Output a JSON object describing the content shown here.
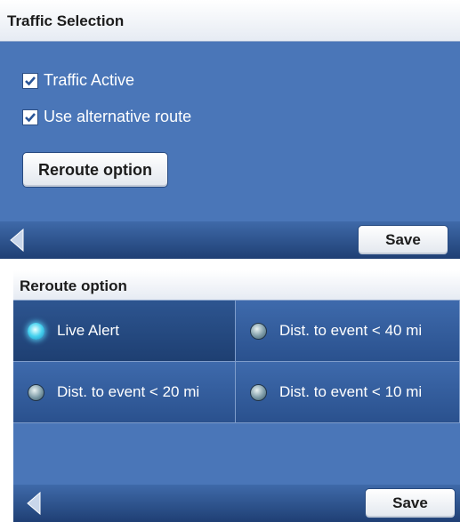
{
  "traffic_selection": {
    "title": "Traffic Selection",
    "checkboxes": [
      {
        "label": "Traffic Active",
        "checked": true
      },
      {
        "label": "Use alternative route",
        "checked": true
      }
    ],
    "reroute_button": "Reroute option",
    "save_label": "Save"
  },
  "reroute_option": {
    "title": "Reroute option",
    "options": [
      {
        "label": "Live Alert",
        "selected": true
      },
      {
        "label": "Dist. to event < 40 mi",
        "selected": false
      },
      {
        "label": "Dist. to event < 20 mi",
        "selected": false
      },
      {
        "label": "Dist. to event < 10 mi",
        "selected": false
      }
    ],
    "save_label": "Save"
  },
  "colors": {
    "panel_blue": "#4a76b8",
    "bar_dark": "#1f3f74",
    "radio_active": "#45d1ee"
  }
}
